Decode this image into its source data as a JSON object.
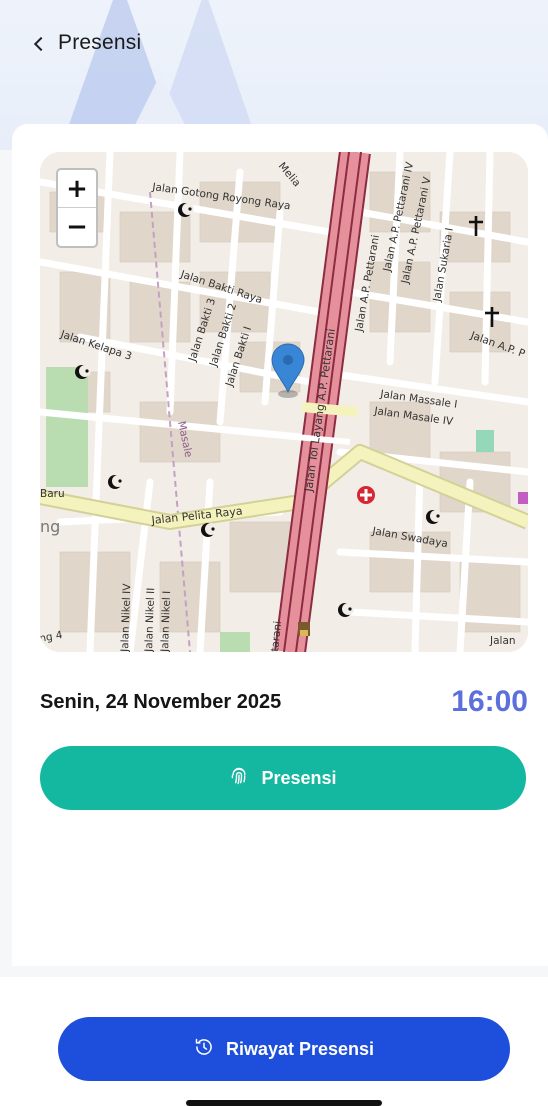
{
  "header": {
    "title": "Presensi"
  },
  "map": {
    "zoom_in": "+",
    "zoom_out": "−",
    "labels": {
      "melia": "Melia",
      "gotong_royong": "Jalan Gotong Royong Raya",
      "pettarani_iv": "Jalan A.P. Pettarani IV",
      "pettarani_v": "Jalan A.P. Pettarani V",
      "sukaria": "Jalan Sukaria I",
      "pettarani_main": "Jalan A.P. Pettarani",
      "ap_p": "Jalan A.P. P",
      "bakti_raya": "Jalan Bakti Raya",
      "bakti_3": "Jalan Bakti 3",
      "bakti_2": "Jalan Bakti 2",
      "bakti_1": "Jalan Bakti I",
      "kelapa_3": "Jalan Kelapa 3",
      "tol_layang": "Jalan Tol Layang A.P. Pettarani",
      "massale_i": "Jalan Massale I",
      "masale_iv": "Jalan Masale IV",
      "masale": "Masale",
      "baru": "Baru",
      "ng": "ng",
      "pelita_raya": "Jalan Pelita Raya",
      "swadaya": "Jalan Swadaya",
      "nikel_iv": "Jalan Nikel IV",
      "nikel_ii": "Jalan Nikel II",
      "nikel_i": "Jalan Nikel I",
      "ng4": "ng 4",
      "tarani": "tarani",
      "jalan": "Jalan"
    }
  },
  "attendance": {
    "date": "Senin, 24 November 2025",
    "time": "16:00",
    "button_label": "Presensi"
  },
  "footer": {
    "history_button_label": "Riwayat Presensi"
  },
  "colors": {
    "primary_teal": "#14b79f",
    "primary_blue": "#1e4fdc",
    "time_accent": "#5b6fdd",
    "map_pin": "#3a86d6",
    "road_main": "#e8909a"
  },
  "icons": {
    "back": "chevron-left-icon",
    "fingerprint": "fingerprint-icon",
    "history": "history-icon",
    "location_pin": "location-pin-icon"
  }
}
